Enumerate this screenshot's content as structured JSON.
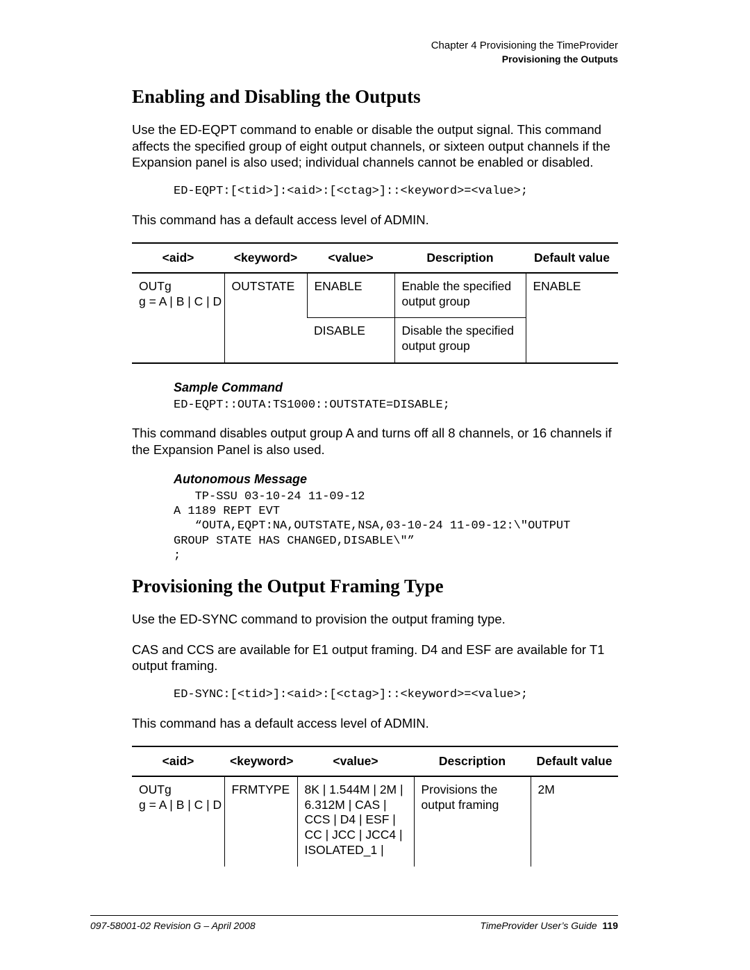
{
  "header": {
    "chapter": "Chapter 4 Provisioning the TimeProvider",
    "section": "Provisioning the Outputs"
  },
  "s1": {
    "title": "Enabling and Disabling the Outputs",
    "p1": "Use the ED-EQPT command to enable or disable the output signal. This command affects the specified group of eight output channels, or sixteen output channels if the Expansion panel is also used; individual channels cannot be enabled or disabled.",
    "cmd": "ED-EQPT:[<tid>]:<aid>:[<ctag>]::<keyword>=<value>;",
    "p2": "This command has a default access level of ADMIN.",
    "th": {
      "aid": "<aid>",
      "kw": "<keyword>",
      "val": "<value>",
      "desc": "Description",
      "def": "Default value"
    },
    "r1": {
      "aid1": "OUTg",
      "aid2": "g = A | B | C | D",
      "kw": "OUTSTATE",
      "val": "ENABLE",
      "desc": "Enable the specified output group",
      "def": "ENABLE"
    },
    "r2": {
      "val": "DISABLE",
      "desc": "Disable the specified output group"
    },
    "sample_h": "Sample Command",
    "sample": "ED-EQPT::OUTA:TS1000::OUTSTATE=DISABLE;",
    "p3": "This command disables output group A and turns off all 8 channels, or 16 channels if the Expansion Panel is also used.",
    "auto_h": "Autonomous Message",
    "auto": "   TP-SSU 03-10-24 11-09-12\nA 1189 REPT EVT\n   “OUTA,EQPT:NA,OUTSTATE,NSA,03-10-24 11-09-12:\\\"OUTPUT\nGROUP STATE HAS CHANGED,DISABLE\\\"”\n;"
  },
  "s2": {
    "title": "Provisioning the Output Framing Type",
    "p1": "Use the ED-SYNC command to provision the output framing type.",
    "p2": "CAS and CCS are available for E1 output framing. D4 and ESF are available for T1 output framing.",
    "cmd": "ED-SYNC:[<tid>]:<aid>:[<ctag>]::<keyword>=<value>;",
    "p3": "This command has a default access level of ADMIN.",
    "th": {
      "aid": "<aid>",
      "kw": "<keyword>",
      "val": "<value>",
      "desc": "Description",
      "def": "Default value"
    },
    "r1": {
      "aid1": "OUTg",
      "aid2": "g = A | B | C | D",
      "kw": "FRMTYPE",
      "val": "8K | 1.544M | 2M | 6.312M | CAS | CCS | D4 | ESF | CC | JCC | JCC4 | ISOLATED_1 |",
      "desc": "Provisions the output framing",
      "def": "2M"
    }
  },
  "footer": {
    "left": "097-58001-02 Revision G – April 2008",
    "right_title": "TimeProvider User’s Guide",
    "page": "119"
  }
}
